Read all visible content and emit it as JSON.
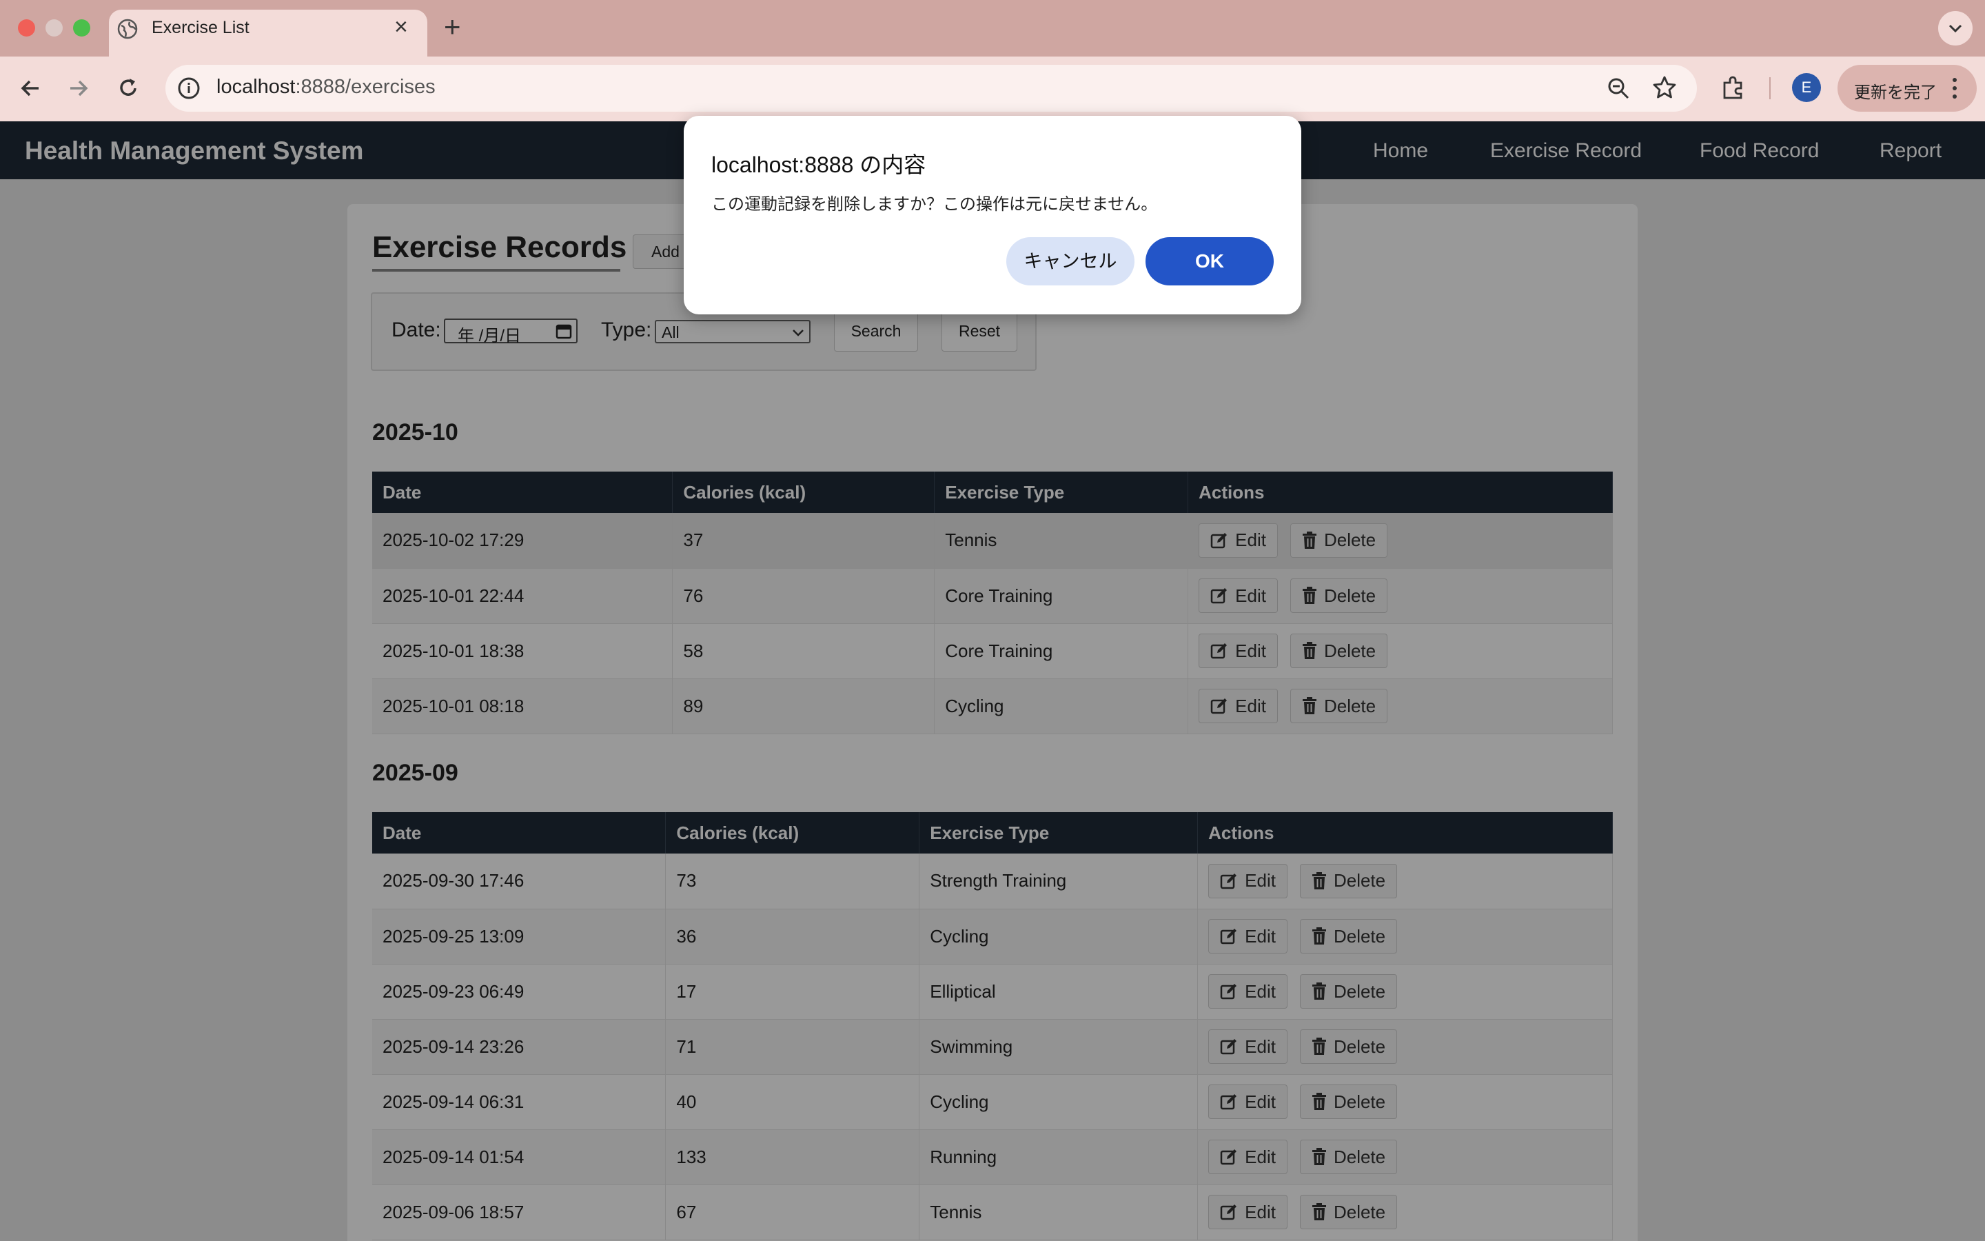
{
  "browser": {
    "tab_title": "Exercise List",
    "url_host": "localhost",
    "url_rest": ":8888/exercises",
    "profile_initial": "E",
    "update_label": "更新を完了"
  },
  "app": {
    "brand": "Health Management System",
    "nav": [
      "Home",
      "Exercise Record",
      "Food Record",
      "Report"
    ]
  },
  "page": {
    "title": "Exercise Records",
    "add_label": "Add",
    "filter": {
      "date_label": "Date:",
      "date_placeholder": "年 /月/日",
      "type_label": "Type:",
      "type_selected": "All",
      "search_label": "Search",
      "reset_label": "Reset"
    }
  },
  "table": {
    "columns": [
      "Date",
      "Calories (kcal)",
      "Exercise Type",
      "Actions"
    ],
    "edit_label": "Edit",
    "delete_label": "Delete"
  },
  "sections": [
    {
      "title": "2025-10",
      "rows": [
        [
          "2025-10-02 17:29",
          "37",
          "Tennis"
        ],
        [
          "2025-10-01 22:44",
          "76",
          "Core Training"
        ],
        [
          "2025-10-01 18:38",
          "58",
          "Core Training"
        ],
        [
          "2025-10-01 08:18",
          "89",
          "Cycling"
        ]
      ]
    },
    {
      "title": "2025-09",
      "rows": [
        [
          "2025-09-30 17:46",
          "73",
          "Strength Training"
        ],
        [
          "2025-09-25 13:09",
          "36",
          "Cycling"
        ],
        [
          "2025-09-23 06:49",
          "17",
          "Elliptical"
        ],
        [
          "2025-09-14 23:26",
          "71",
          "Swimming"
        ],
        [
          "2025-09-14 06:31",
          "40",
          "Cycling"
        ],
        [
          "2025-09-14 01:54",
          "133",
          "Running"
        ],
        [
          "2025-09-06 18:57",
          "67",
          "Tennis"
        ]
      ]
    }
  ],
  "dialog": {
    "title": "localhost:8888 の内容",
    "message": "この運動記録を削除しますか？この操作は元に戻せません。",
    "cancel_label": "キャンセル",
    "ok_label": "OK"
  },
  "colors": {
    "tabstrip": "#cfa6a1",
    "toolbar": "#f3dcd9",
    "navbar": "#1e2a38",
    "ok_button": "#2355c8"
  }
}
